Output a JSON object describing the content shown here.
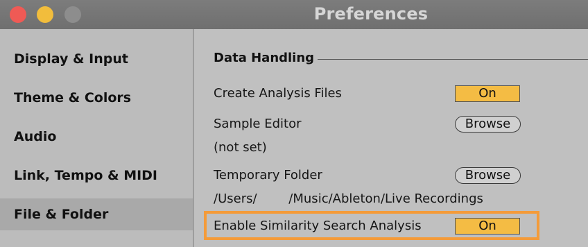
{
  "window": {
    "title": "Preferences"
  },
  "sidebar": {
    "items": [
      {
        "label": "Display & Input",
        "selected": false
      },
      {
        "label": "Theme & Colors",
        "selected": false
      },
      {
        "label": "Audio",
        "selected": false
      },
      {
        "label": "Link, Tempo & MIDI",
        "selected": false
      },
      {
        "label": "File & Folder",
        "selected": true
      }
    ]
  },
  "content": {
    "section_title": "Data Handling",
    "rows": [
      {
        "label": "Create Analysis Files",
        "control": "On"
      },
      {
        "label": "Sample Editor",
        "control": "Browse",
        "value": "(not set)"
      },
      {
        "label": "Temporary Folder",
        "control": "Browse",
        "value": "/Users/        /Music/Ableton/Live Recordings"
      },
      {
        "label": "Enable Similarity Search Analysis",
        "control": "On"
      }
    ]
  },
  "colors": {
    "toggle_on": "#f4bc44",
    "highlight": "#f49b39",
    "close": "#ef5a55",
    "minimize": "#f2bd3c",
    "zoom_disabled": "#8d8d8d"
  }
}
